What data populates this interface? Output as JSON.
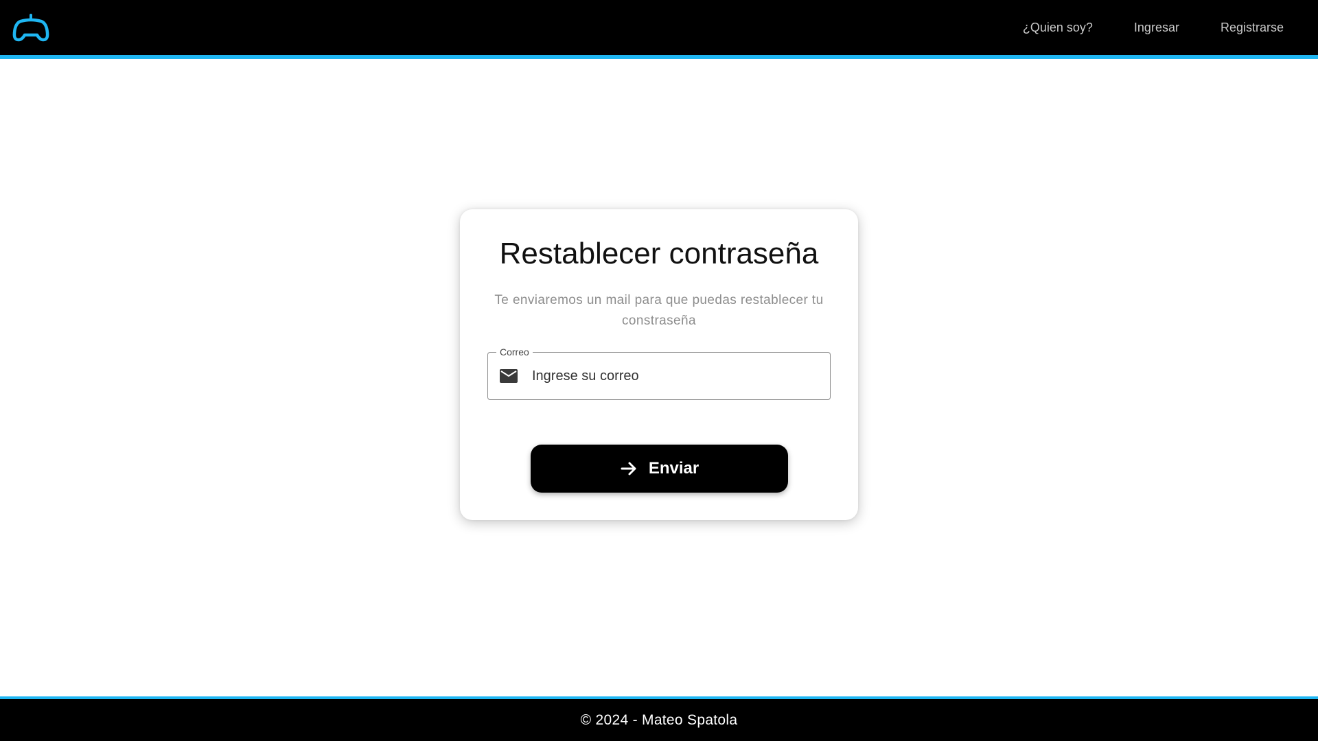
{
  "header": {
    "logo_icon": "gamepad-icon",
    "accent_color": "#1fb6f2",
    "nav": [
      {
        "label": "¿Quien soy?"
      },
      {
        "label": "Ingresar"
      },
      {
        "label": "Registrarse"
      }
    ]
  },
  "reset_card": {
    "title": "Restablecer contraseña",
    "subtitle": "Te enviaremos un mail para que puedas restablecer tu constraseña",
    "email_field": {
      "label": "Correo",
      "placeholder": "Ingrese su correo",
      "value": "",
      "icon": "mail-icon"
    },
    "submit": {
      "label": "Enviar",
      "icon": "arrow-right-icon"
    }
  },
  "footer": {
    "text": "© 2024 - Mateo Spatola"
  }
}
